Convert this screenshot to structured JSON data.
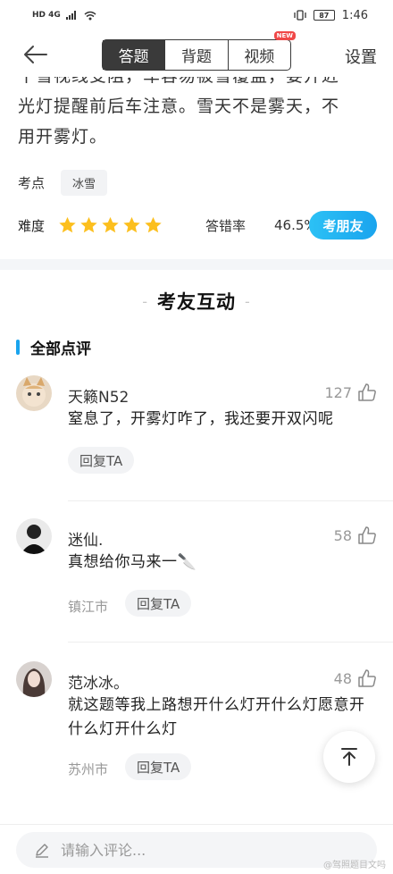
{
  "status_bar": {
    "left_text": "HD 4G",
    "battery": "87",
    "time": "1:46"
  },
  "navbar": {
    "tabs": [
      {
        "label": "答题",
        "active": true
      },
      {
        "label": "背题",
        "active": false
      },
      {
        "label": "视频",
        "active": false,
        "badge": "NEW"
      }
    ],
    "settings_label": "设置"
  },
  "explanation": {
    "partial_line": "十雪视线受阻，车容易被雪覆盖，要开近",
    "lines": [
      "光灯提醒前后车注意。雪天不是雾天，不",
      "用开雾灯。"
    ]
  },
  "knowledge": {
    "label": "考点",
    "tag": "冰雪"
  },
  "difficulty": {
    "label": "难度",
    "stars": 5,
    "error_label": "答错率",
    "error_rate": "46.5%",
    "ask_button": "考朋友"
  },
  "section": {
    "title": "考友互动",
    "dash": "-",
    "all_comments_label": "全部点评"
  },
  "comments": [
    {
      "name": "天籁N52",
      "likes": "127",
      "text": "窒息了，开雾灯咋了，我还要开双闪呢",
      "location": "",
      "reply": "回复TA"
    },
    {
      "name": "迷仙.",
      "likes": "58",
      "text": "真想给你马来一🔪",
      "location": "镇江市",
      "reply": "回复TA"
    },
    {
      "name": "范冰冰。",
      "likes": "48",
      "text": "就这题等我上路想开什么灯开什么灯愿意开什么灯开什么灯",
      "location": "苏州市",
      "reply": "回复TA"
    }
  ],
  "input": {
    "placeholder": "请输入评论..."
  },
  "watermark": "@驾照题目文吗",
  "colors": {
    "accent": "#1aa4ee",
    "star": "#fcbf1e",
    "dark_tab": "#3a3a3a"
  }
}
